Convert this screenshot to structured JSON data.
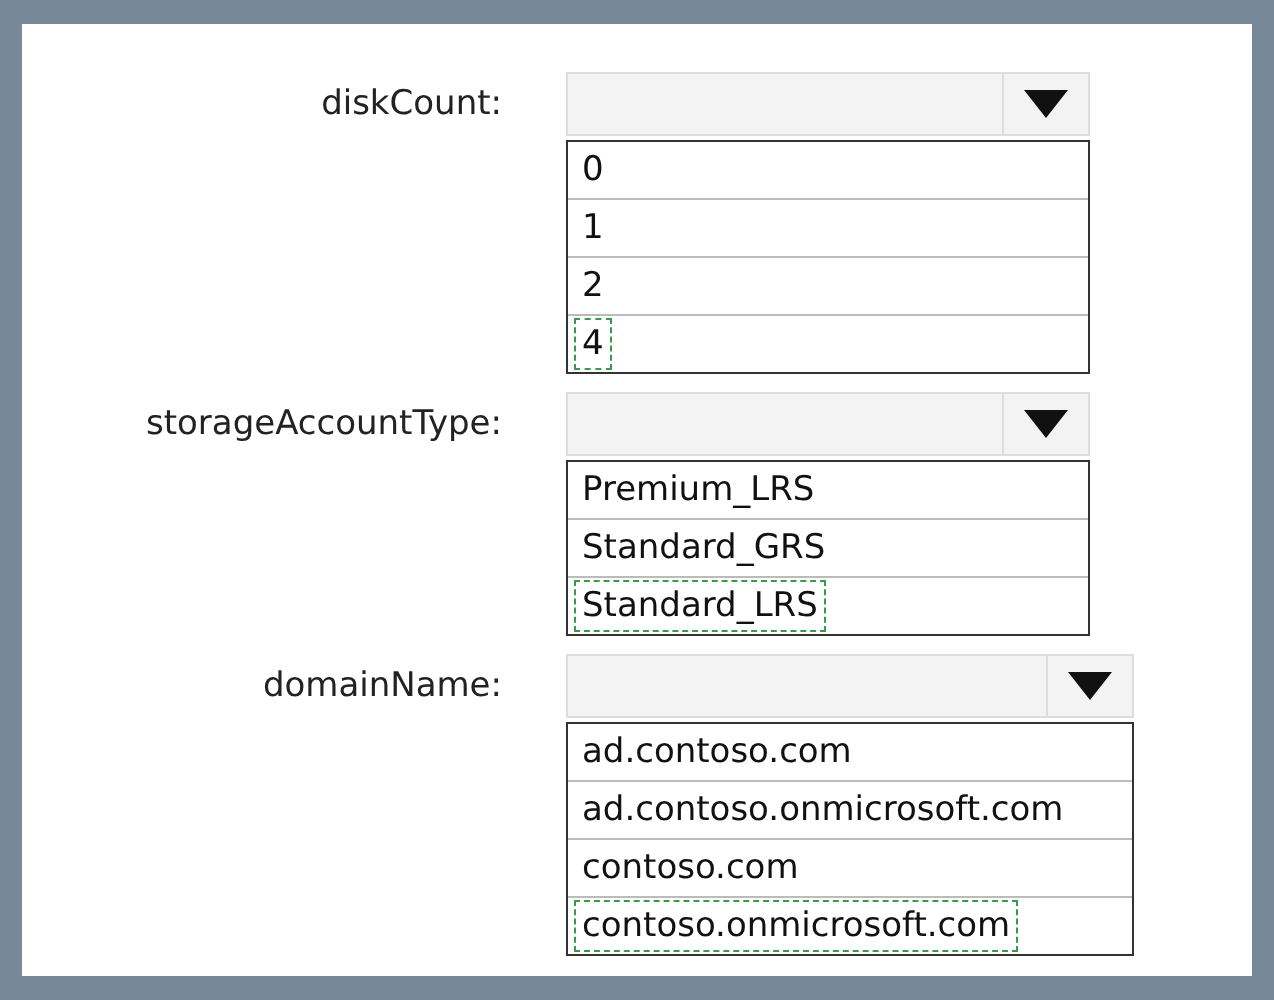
{
  "fields": [
    {
      "label": "diskCount:",
      "options": [
        {
          "text": "0",
          "selected": false
        },
        {
          "text": "1",
          "selected": false
        },
        {
          "text": "2",
          "selected": false
        },
        {
          "text": "4",
          "selected": true
        }
      ]
    },
    {
      "label": "storageAccountType:",
      "options": [
        {
          "text": "Premium_LRS",
          "selected": false
        },
        {
          "text": "Standard_GRS",
          "selected": false
        },
        {
          "text": "Standard_LRS",
          "selected": true
        }
      ]
    },
    {
      "label": "domainName:",
      "options": [
        {
          "text": "ad.contoso.com",
          "selected": false
        },
        {
          "text": "ad.contoso.onmicrosoft.com",
          "selected": false
        },
        {
          "text": "contoso.com",
          "selected": false
        },
        {
          "text": "contoso.onmicrosoft.com",
          "selected": true
        }
      ]
    }
  ]
}
